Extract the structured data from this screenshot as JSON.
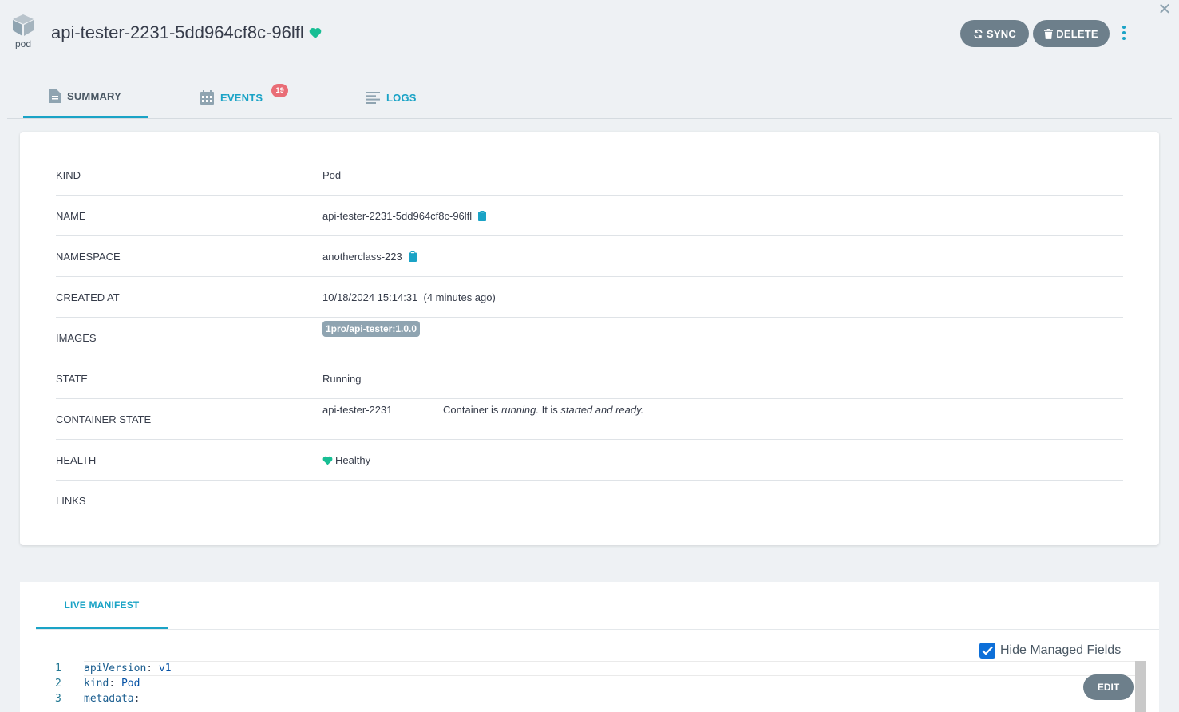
{
  "header": {
    "kind_icon": "cube-icon",
    "kind_label": "pod",
    "title": "api-tester-2231-5dd964cf8c-96lfl",
    "health_icon": "heart-icon",
    "sync_label": "SYNC",
    "delete_label": "DELETE",
    "more_icon": "kebab-icon",
    "close_icon": "close-icon"
  },
  "tabs": [
    {
      "label": "SUMMARY",
      "icon": "document-icon",
      "active": true
    },
    {
      "label": "EVENTS",
      "icon": "calendar-icon",
      "badge": "19"
    },
    {
      "label": "LOGS",
      "icon": "align-left-icon"
    }
  ],
  "summary": {
    "kind": {
      "label": "KIND",
      "value": "Pod"
    },
    "name": {
      "label": "NAME",
      "value": "api-tester-2231-5dd964cf8c-96lfl"
    },
    "namespace": {
      "label": "NAMESPACE",
      "value": "anotherclass-223"
    },
    "created_at": {
      "label": "CREATED AT",
      "value": "10/18/2024 15:14:31  (4 minutes ago)"
    },
    "images": {
      "label": "IMAGES",
      "value": "1pro/api-tester:1.0.0"
    },
    "state": {
      "label": "STATE",
      "value": "Running"
    },
    "container_state": {
      "label": "CONTAINER STATE",
      "container": "api-tester-2231",
      "msg_prefix": "Container is ",
      "msg_running": "running.",
      "msg_mid": " It is ",
      "msg_ready": "started and ready."
    },
    "health": {
      "label": "HEALTH",
      "value": "Healthy"
    },
    "links": {
      "label": "LINKS"
    }
  },
  "manifest": {
    "tab_label": "LIVE MANIFEST",
    "hide_managed_label": "Hide Managed Fields",
    "hide_managed_checked": true,
    "edit_label": "EDIT",
    "lines": [
      {
        "n": "1",
        "key": "apiVersion",
        "value": "v1"
      },
      {
        "n": "2",
        "key": "kind",
        "value": "Pod"
      },
      {
        "n": "3",
        "key": "metadata",
        "value": ""
      }
    ]
  },
  "colors": {
    "accent": "#1aa3c6",
    "healthy": "#18be94",
    "button": "#6d7f8b",
    "badge": "#e96d76"
  }
}
